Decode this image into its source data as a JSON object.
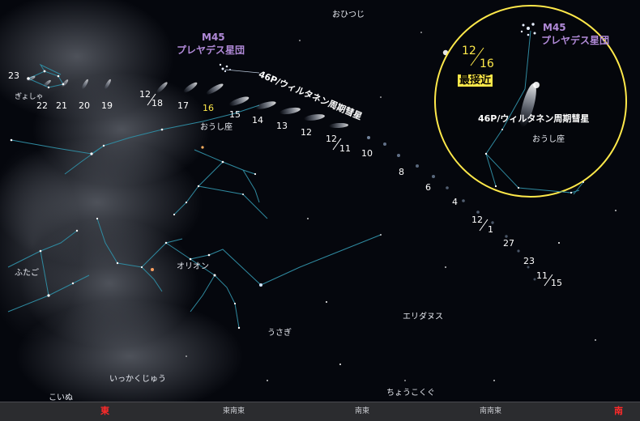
{
  "map": {
    "constellations": {
      "aries": "おひつじ",
      "auriga": "おうし座",
      "auriga_inset": "おうし座",
      "perseus": "ぎょしゃ",
      "gemini": "ふたご",
      "orion": "オリオン",
      "lepus": "うさぎ",
      "eridanus": "エリダヌス",
      "monoceros": "いっかくじゅう",
      "canis_minor": "こいぬ",
      "caelum": "ちょうこくぐ"
    },
    "pleiades": {
      "line1": "M45",
      "line2": "プレヤデス星団"
    },
    "comet_label": "46P/ウィルタネン周期彗星",
    "dates": {
      "d23": "23",
      "d22": "22",
      "d21": "21",
      "d20": "20",
      "d19": "19",
      "d12_18_m": "12",
      "d12_18_d": "18",
      "d17": "17",
      "d16": "16",
      "d15": "15",
      "d14": "14",
      "d13": "13",
      "d12": "12",
      "d12_11_m": "12",
      "d12_11_d": "11",
      "d10": "10",
      "d8": "8",
      "d6": "6",
      "d4": "4",
      "d12_1_m": "12",
      "d12_1_d": "1",
      "d27": "27",
      "d23b": "23",
      "d11_15_m": "11",
      "d11_15_d": "15"
    },
    "inset": {
      "month": "12",
      "day": "16",
      "closest": "最接近",
      "pleiades1": "M45",
      "pleiades2": "プレヤデス星団",
      "comet": "46P/ウィルタネン周期彗星"
    },
    "directions": {
      "east": "東",
      "ene": "東南東",
      "se": "南東",
      "sse": "南南東",
      "south": "南"
    },
    "colors": {
      "constellation_line": "#2f8aa0",
      "highlight": "#ffe94a",
      "pleiades_label": "#b18ad8",
      "cardinal": "#ff2a2a"
    }
  }
}
